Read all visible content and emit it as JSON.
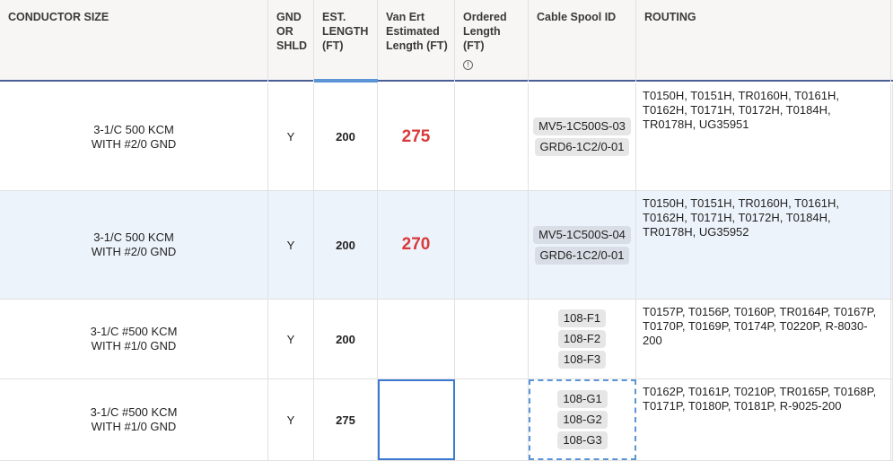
{
  "columns": {
    "conductor": "CONDUCTOR SIZE",
    "gnd": "GND OR SHLD",
    "est": "EST. LENGTH (FT)",
    "van": "Van Ert Estimated Length (FT)",
    "ordered": "Ordered Length (FT)",
    "spool": "Cable Spool ID",
    "routing": "ROUTING"
  },
  "ordered_info_icon": "info-icon",
  "rows": [
    {
      "c1": "3-1/C 500 KCM",
      "c2": "WITH #2/0 GND",
      "gnd": "Y",
      "est": "200",
      "van": "275",
      "ordered": "",
      "spools": [
        "MV5-1C500S-03",
        "GRD6-1C2/0-01"
      ],
      "routing": "T0150H, T0151H, TR0160H, T0161H, T0162H, T0171H, T0172H, T0184H, TR0178H, UG35951"
    },
    {
      "c1": "3-1/C 500 KCM",
      "c2": "WITH #2/0 GND",
      "gnd": "Y",
      "est": "200",
      "van": "270",
      "ordered": "",
      "spools": [
        "MV5-1C500S-04",
        "GRD6-1C2/0-01"
      ],
      "routing": "T0150H, T0151H, TR0160H, T0161H, T0162H, T0171H, T0172H, T0184H, TR0178H, UG35952"
    },
    {
      "c1": "3-1/C #500 KCM",
      "c2": "WITH #1/0 GND",
      "gnd": "Y",
      "est": "200",
      "van": "",
      "ordered": "",
      "spools": [
        "108-F1",
        "108-F2",
        "108-F3"
      ],
      "routing": "T0157P, T0156P, T0160P, TR0164P, T0167P, T0170P, T0169P, T0174P, T0220P, R-8030-200"
    },
    {
      "c1": "3-1/C #500 KCM",
      "c2": "WITH #1/0 GND",
      "gnd": "Y",
      "est": "275",
      "van": "",
      "ordered": "",
      "spools": [
        "108-G1",
        "108-G2",
        "108-G3"
      ],
      "routing": "T0162P, T0161P, T0210P, TR0165P, T0168P, T0171P, T0180P, T0181P, R-9025-200"
    }
  ]
}
